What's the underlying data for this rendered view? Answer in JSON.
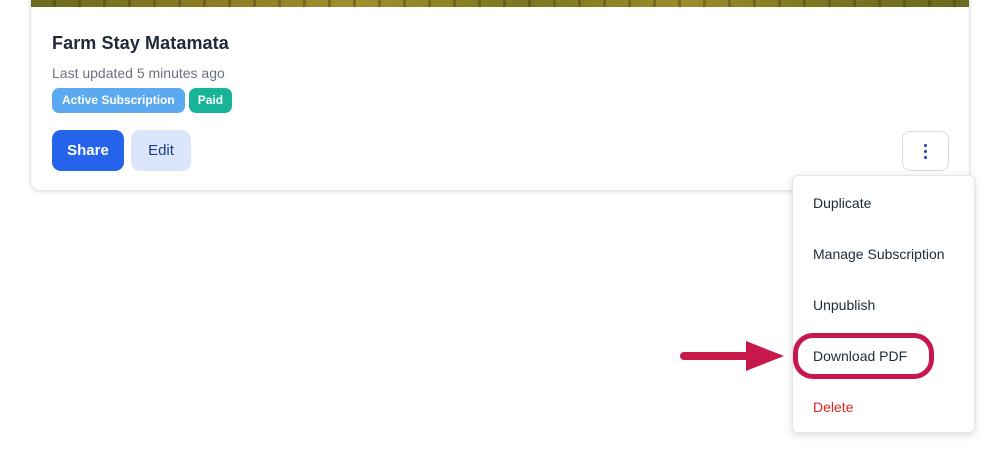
{
  "card": {
    "title": "Farm Stay Matamata",
    "updated": "Last updated 5 minutes ago",
    "badges": [
      "Active Subscription",
      "Paid"
    ],
    "actions": {
      "share": "Share",
      "edit": "Edit",
      "more_icon": "kebab-vertical-icon"
    }
  },
  "menu": {
    "items": [
      {
        "label": "Duplicate"
      },
      {
        "label": "Manage Subscription"
      },
      {
        "label": "Unpublish"
      },
      {
        "label": "Download PDF"
      },
      {
        "label": "Delete"
      }
    ]
  },
  "colors": {
    "primary": "#2563eb",
    "badge_subscription": "#5aa9f1",
    "badge_paid": "#18b49a",
    "danger": "#dc2626",
    "annotation": "#c8174a"
  }
}
